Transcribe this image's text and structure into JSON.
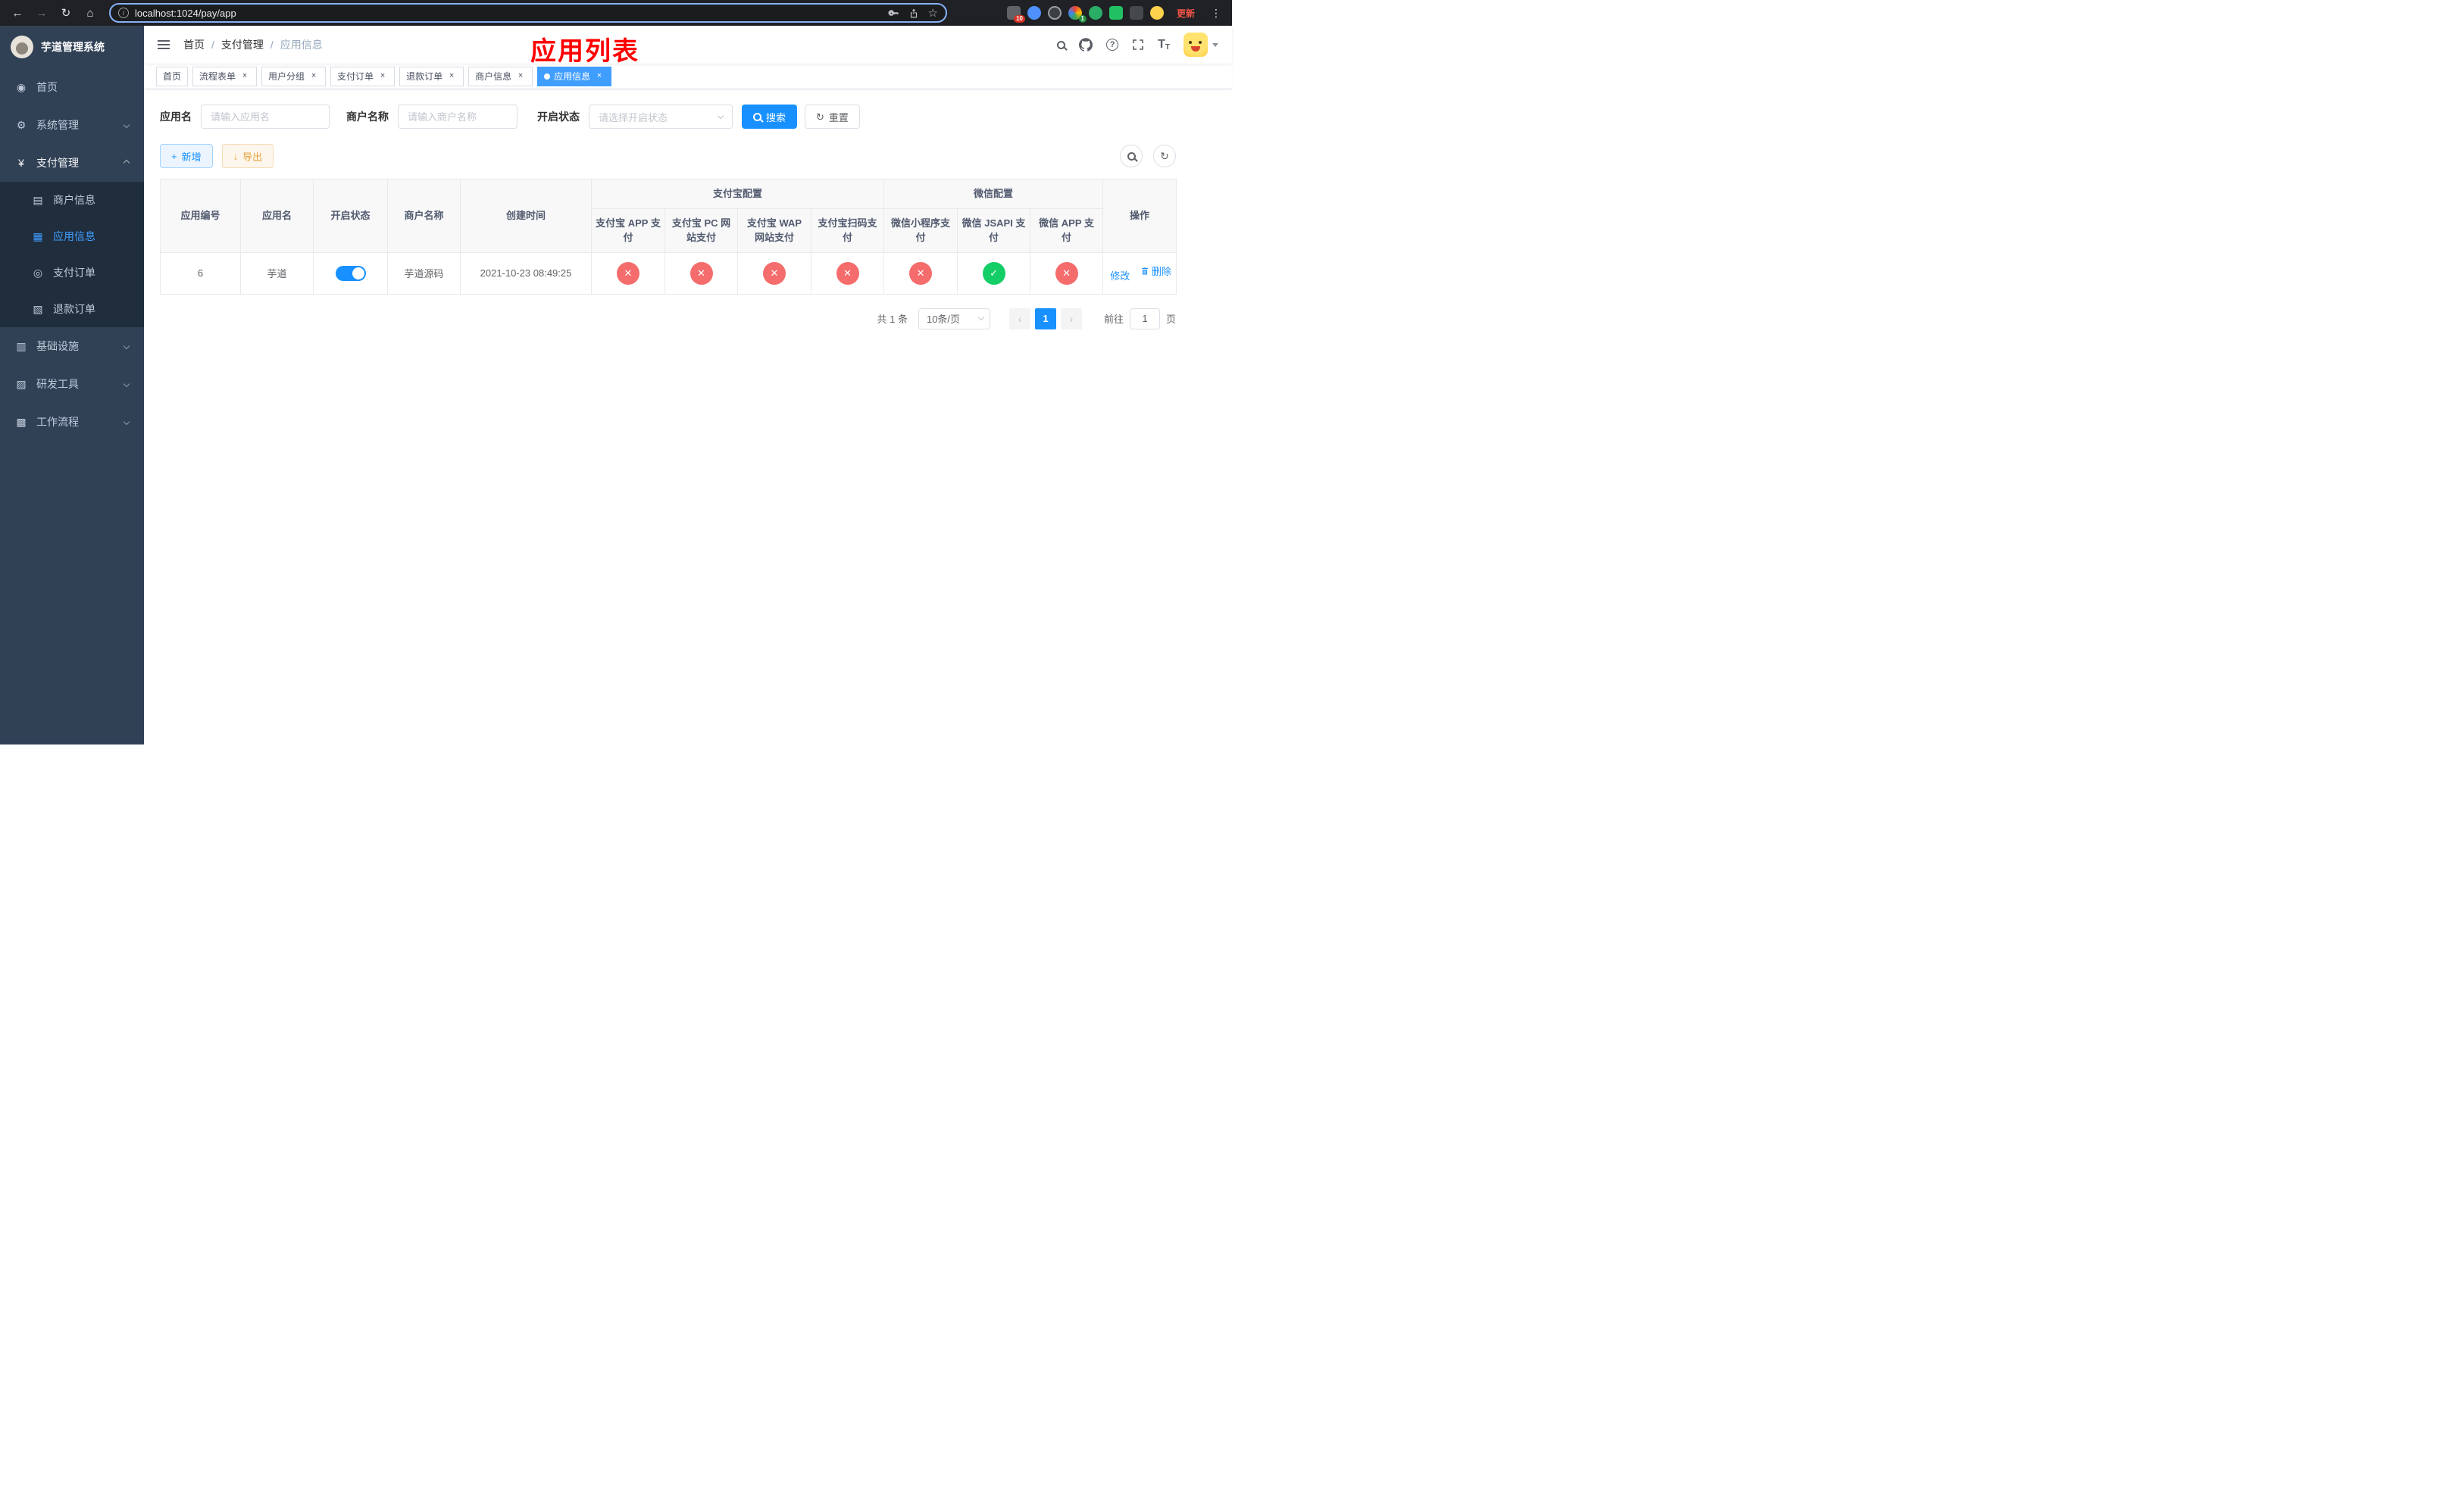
{
  "browser": {
    "url": "localhost:1024/pay/app",
    "update_label": "更新",
    "ext_badges": [
      "10",
      "1"
    ]
  },
  "icons": {
    "back": "←",
    "forward": "→",
    "reload": "↻",
    "home": "⌂",
    "star": "☆",
    "kebab": "⋮",
    "close": "×",
    "success": "✓",
    "fail": "✕",
    "dashboard": "◉",
    "gear": "⚙",
    "yen": "¥",
    "merchant": "▤",
    "app": "▦",
    "order": "◎",
    "refund": "▧",
    "infra": "▥",
    "tool": "▨",
    "flow": "▩",
    "plus": "+",
    "download": "↓",
    "refresh": "↻",
    "question": "?",
    "fontsize": "T",
    "prev": "‹",
    "next": "›"
  },
  "sidebar": {
    "logo_title": "芋道管理系统",
    "items": [
      {
        "label": "首页"
      },
      {
        "label": "系统管理"
      },
      {
        "label": "支付管理"
      },
      {
        "label": "商户信息"
      },
      {
        "label": "应用信息"
      },
      {
        "label": "支付订单"
      },
      {
        "label": "退款订单"
      },
      {
        "label": "基础设施"
      },
      {
        "label": "研发工具"
      },
      {
        "label": "工作流程"
      }
    ]
  },
  "navbar": {
    "breadcrumb": [
      "首页",
      "支付管理",
      "应用信息"
    ]
  },
  "overlay_title": "应用列表",
  "tabs": [
    {
      "label": "首页"
    },
    {
      "label": "流程表单"
    },
    {
      "label": "用户分组"
    },
    {
      "label": "支付订单"
    },
    {
      "label": "退款订单"
    },
    {
      "label": "商户信息"
    },
    {
      "label": "应用信息"
    }
  ],
  "filters": {
    "app_name_label": "应用名",
    "app_name_placeholder": "请输入应用名",
    "merchant_label": "商户名称",
    "merchant_placeholder": "请输入商户名称",
    "status_label": "开启状态",
    "status_placeholder": "请选择开启状态",
    "search_label": "搜索",
    "reset_label": "重置"
  },
  "toolbar": {
    "add_label": "新增",
    "export_label": "导出"
  },
  "table": {
    "group_alipay": "支付宝配置",
    "group_wechat": "微信配置",
    "columns": [
      "应用编号",
      "应用名",
      "开启状态",
      "商户名称",
      "创建时间",
      "支付宝 APP 支付",
      "支付宝 PC 网站支付",
      "支付宝 WAP 网站支付",
      "支付宝扫码支付",
      "微信小程序支付",
      "微信 JSAPI 支付",
      "微信 APP 支付",
      "操作"
    ],
    "rows": [
      {
        "id": "6",
        "name": "芋道",
        "enabled": true,
        "merchant": "芋道源码",
        "created": "2021-10-23 08:49:25",
        "channels": [
          "fail",
          "fail",
          "fail",
          "fail",
          "fail",
          "success",
          "fail"
        ],
        "edit_label": "修改",
        "delete_label": "删除"
      }
    ]
  },
  "pagination": {
    "total": "共 1 条",
    "page_size": "10条/页",
    "current_page": "1",
    "goto_label": "前往",
    "goto_value": "1",
    "goto_suffix": "页"
  }
}
